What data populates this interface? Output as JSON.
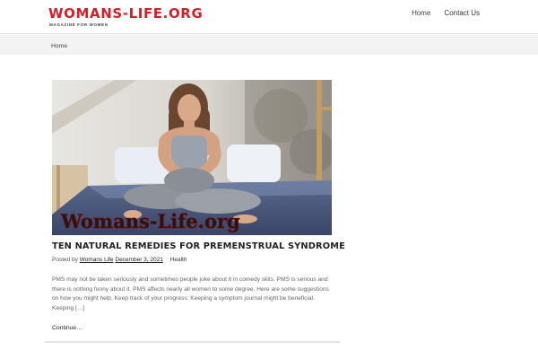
{
  "site": {
    "logo": "WOMANS-LIFE.ORG",
    "tagline": "MAGAZINE FOR WOMEN",
    "brand_color": "#d0202a"
  },
  "nav": {
    "items": [
      "Home",
      "Contact Us"
    ]
  },
  "breadcrumb": {
    "home": "Home"
  },
  "post": {
    "image_watermark": "Womans-Life.org",
    "title": "TEN NATURAL REMEDIES FOR PREMENSTRUAL SYNDROME",
    "posted_by_label": "Posted by",
    "author": "Womans Life",
    "date": "December 3, 2021",
    "category": "Health",
    "excerpt": "PMS may not be taken seriously and sometimes people joke about it in comedy skits. PMS is serious and there is nothing funny about it. PMS affects nearly all women to some degree. Here are some suggestions on how you might help. Keep track of your progress: Keeping a symptom journal might be beneficial. Keeping […]",
    "continue_label": "Continue…"
  }
}
